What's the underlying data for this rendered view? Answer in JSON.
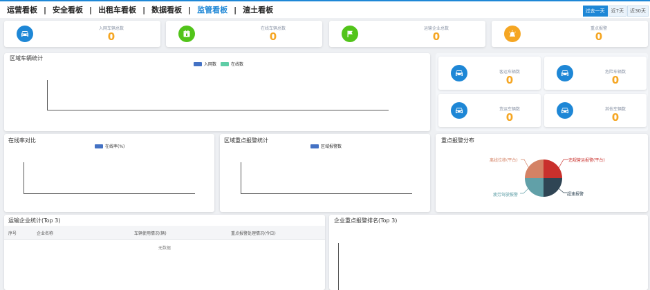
{
  "nav": {
    "tabs": [
      "运营看板",
      "安全看板",
      "出租车看板",
      "数据看板",
      "监管看板",
      "渣土看板"
    ],
    "active_tab": "监管看板",
    "separator": "|",
    "ranges": [
      "过去一天",
      "近7天",
      "近30天"
    ],
    "active_range": "过去一天"
  },
  "stats": [
    {
      "label": "入网车辆总数",
      "value": "0",
      "color": "#1e87d6",
      "icon": "car-icon"
    },
    {
      "label": "在线车辆总数",
      "value": "0",
      "color": "#52c41a",
      "icon": "calendar-icon"
    },
    {
      "label": "运输企业总数",
      "value": "0",
      "color": "#52c41a",
      "icon": "flag-icon"
    },
    {
      "label": "重点报警",
      "value": "0",
      "color": "#f5a623",
      "icon": "alarm-icon"
    }
  ],
  "region_stats": {
    "title": "区域车辆统计",
    "legend": [
      {
        "name": "入网数",
        "color": "#4472c4"
      },
      {
        "name": "在线数",
        "color": "#5fcda6"
      }
    ]
  },
  "vehicle_types": [
    {
      "label": "客运车辆数",
      "value": "0"
    },
    {
      "label": "危险车辆数",
      "value": "0"
    },
    {
      "label": "货运车辆数",
      "value": "0"
    },
    {
      "label": "其他车辆数",
      "value": "0"
    }
  ],
  "online_rate": {
    "title": "在线率对比",
    "legend": [
      {
        "name": "在线率(%)",
        "color": "#4472c4"
      }
    ]
  },
  "region_alarm": {
    "title": "区域重点报警统计",
    "legend": [
      {
        "name": "区域报警数",
        "color": "#4472c4"
      }
    ]
  },
  "alarm_dist": {
    "title": "重点报警分布",
    "slices": [
      {
        "name": "违规营运报警(平台)",
        "color": "#c9302c"
      },
      {
        "name": "超速报警",
        "color": "#2f4554"
      },
      {
        "name": "疲劳驾驶报警",
        "color": "#61a0a8"
      },
      {
        "name": "离线位移(平台)",
        "color": "#d48265"
      }
    ]
  },
  "company_stats": {
    "title": "运输企业统计(Top 3)",
    "columns": [
      "序号",
      "企业名称",
      "车辆使用情况(辆)",
      "重点报警处理情况(今日)"
    ],
    "empty_text": "无数据"
  },
  "company_alarm_rank": {
    "title": "企业重点报警排名(Top 3)"
  }
}
